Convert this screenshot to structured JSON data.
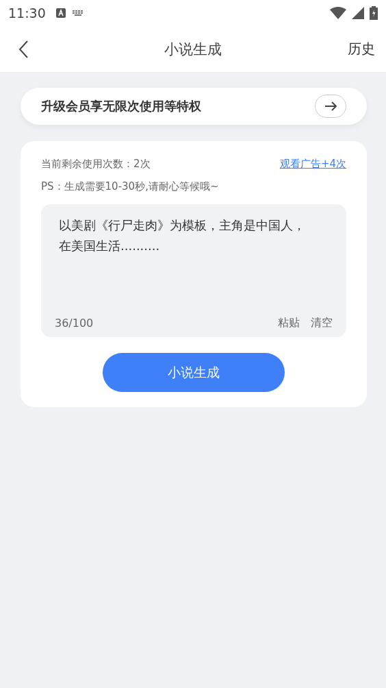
{
  "status_bar": {
    "time": "11:30"
  },
  "header": {
    "title": "小说生成",
    "action": "历史"
  },
  "promo": {
    "text": "升级会员享无限次使用等特权"
  },
  "usage": {
    "remaining": "当前剩余使用次数：2次",
    "ad_link": "观看广告+4次",
    "note": "PS：生成需要10-30秒,请耐心等候哦~"
  },
  "prompt": {
    "value": "以美剧《行尸走肉》为模板，主角是中国人，在美国生活..........",
    "counter": "36/100",
    "actions": [
      "粘贴",
      "清空"
    ]
  },
  "submit": {
    "label": "小说生成"
  }
}
